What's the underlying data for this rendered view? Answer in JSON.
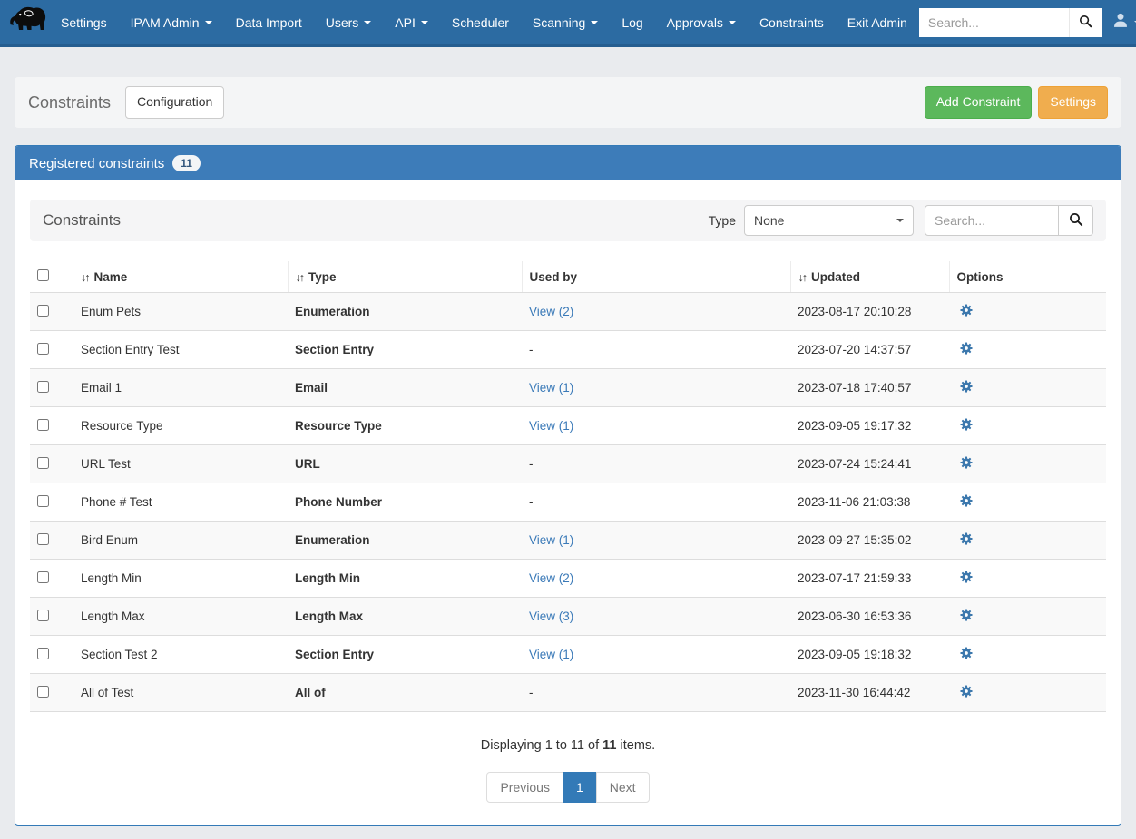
{
  "navbar": {
    "brand_icon": "elephant-logo",
    "items": [
      {
        "label": "Settings",
        "caret": false
      },
      {
        "label": "IPAM Admin",
        "caret": true
      },
      {
        "label": "Data Import",
        "caret": false
      },
      {
        "label": "Users",
        "caret": true
      },
      {
        "label": "API",
        "caret": true
      },
      {
        "label": "Scheduler",
        "caret": false
      },
      {
        "label": "Scanning",
        "caret": true
      },
      {
        "label": "Log",
        "caret": false
      },
      {
        "label": "Approvals",
        "caret": true
      },
      {
        "label": "Constraints",
        "caret": false
      },
      {
        "label": "Exit Admin",
        "caret": false
      }
    ],
    "search_placeholder": "Search..."
  },
  "toolbar": {
    "page_title": "Constraints",
    "configuration_label": "Configuration",
    "add_constraint_label": "Add Constraint",
    "settings_label": "Settings"
  },
  "panel": {
    "title": "Registered constraints",
    "count_badge": "11"
  },
  "filter": {
    "title": "Constraints",
    "type_label": "Type",
    "type_selected": "None",
    "search_placeholder": "Search..."
  },
  "table": {
    "columns": [
      {
        "label": "Name",
        "sortable": true
      },
      {
        "label": "Type",
        "sortable": true
      },
      {
        "label": "Used by",
        "sortable": false
      },
      {
        "label": "Updated",
        "sortable": true
      },
      {
        "label": "Options",
        "sortable": false
      }
    ],
    "rows": [
      {
        "name": "Enum Pets",
        "type": "Enumeration",
        "used_by": "View (2)",
        "updated": "2023-08-17 20:10:28"
      },
      {
        "name": "Section Entry Test",
        "type": "Section Entry",
        "used_by": "-",
        "updated": "2023-07-20 14:37:57"
      },
      {
        "name": "Email 1",
        "type": "Email",
        "used_by": "View (1)",
        "updated": "2023-07-18 17:40:57"
      },
      {
        "name": "Resource Type",
        "type": "Resource Type",
        "used_by": "View (1)",
        "updated": "2023-09-05 19:17:32"
      },
      {
        "name": "URL Test",
        "type": "URL",
        "used_by": "-",
        "updated": "2023-07-24 15:24:41"
      },
      {
        "name": "Phone # Test",
        "type": "Phone Number",
        "used_by": "-",
        "updated": "2023-11-06 21:03:38"
      },
      {
        "name": "Bird Enum",
        "type": "Enumeration",
        "used_by": "View (1)",
        "updated": "2023-09-27 15:35:02"
      },
      {
        "name": "Length Min",
        "type": "Length Min",
        "used_by": "View (2)",
        "updated": "2023-07-17 21:59:33"
      },
      {
        "name": "Length Max",
        "type": "Length Max",
        "used_by": "View (3)",
        "updated": "2023-06-30 16:53:36"
      },
      {
        "name": "Section Test 2",
        "type": "Section Entry",
        "used_by": "View (1)",
        "updated": "2023-09-05 19:18:32"
      },
      {
        "name": "All of Test",
        "type": "All of",
        "used_by": "-",
        "updated": "2023-11-30 16:44:42"
      }
    ]
  },
  "icons": {
    "sort": "↓↑"
  },
  "colors": {
    "navbar": "#2c6ba2",
    "panel_header": "#3d7cb9",
    "add_button": "#5cb85c",
    "settings_button": "#f0ad4e",
    "link": "#3b7ab8",
    "active_page": "#337ab7"
  },
  "footer": {
    "summary_prefix": "Displaying 1 to 11 of ",
    "summary_count": "11",
    "summary_suffix": " items.",
    "previous_label": "Previous",
    "page_label": "1",
    "next_label": "Next"
  }
}
